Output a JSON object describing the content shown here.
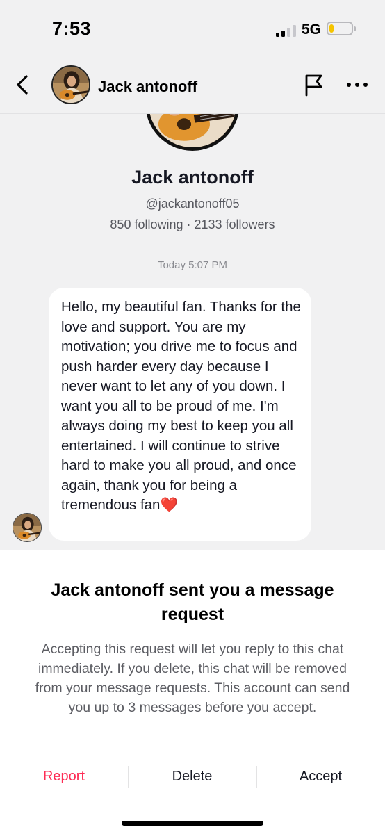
{
  "status_bar": {
    "time": "7:53",
    "network": "5G",
    "battery_level": 0.2,
    "battery_color": "#f5c400"
  },
  "header": {
    "back_icon": "chevron-left-icon",
    "name": "Jack antonoff",
    "report_icon": "flag-icon",
    "more_icon": "more-horizontal-icon"
  },
  "profile": {
    "name": "Jack antonoff",
    "handle": "@jackantonoff05",
    "stats": "850 following · 2133 followers"
  },
  "chat": {
    "timestamp": "Today 5:07 PM",
    "message": "Hello, my beautiful fan. Thanks for the love and support. You are my motivation; you drive me to focus and push harder every day because I never want to let any of you down. I want you all to be proud of me. I'm always doing my best to keep you all entertained. I will continue to strive hard to make you all proud, and once again, thank you for being a tremendous fan❤️"
  },
  "request_sheet": {
    "title": "Jack antonoff sent you a message request",
    "description": "Accepting this request will let you reply to this chat immediately. If you delete, this chat will be removed from your message requests. This account can send you up to 3 messages before you accept.",
    "report_label": "Report",
    "delete_label": "Delete",
    "accept_label": "Accept",
    "report_color": "#fe2c55"
  }
}
